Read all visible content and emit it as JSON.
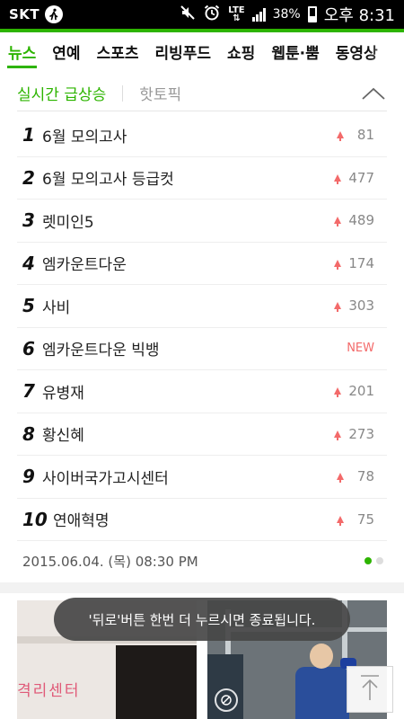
{
  "status_bar": {
    "carrier": "SKT",
    "network": "LTE",
    "battery": "38%",
    "time": "오후 8:31",
    "icons": [
      "running-person-icon",
      "mute-icon",
      "alarm-icon",
      "lte-icon",
      "signal-icon",
      "battery-icon"
    ]
  },
  "tabs": [
    {
      "label": "뉴스",
      "active": true
    },
    {
      "label": "연예",
      "active": false
    },
    {
      "label": "스포츠",
      "active": false
    },
    {
      "label": "리빙푸드",
      "active": false
    },
    {
      "label": "쇼핑",
      "active": false
    },
    {
      "label": "웹툰·뿜",
      "active": false
    },
    {
      "label": "동영상",
      "active": false
    }
  ],
  "panel": {
    "active_tab": "실시간 급상승",
    "inactive_tab": "핫토픽",
    "collapse_icon": "chevron-up-icon"
  },
  "ranking": [
    {
      "rank": "1",
      "term": "6월 모의고사",
      "trend": "up",
      "change": "81"
    },
    {
      "rank": "2",
      "term": "6월 모의고사 등급컷",
      "trend": "up",
      "change": "477"
    },
    {
      "rank": "3",
      "term": "렛미인5",
      "trend": "up",
      "change": "489"
    },
    {
      "rank": "4",
      "term": "엠카운트다운",
      "trend": "up",
      "change": "174"
    },
    {
      "rank": "5",
      "term": "사비",
      "trend": "up",
      "change": "303"
    },
    {
      "rank": "6",
      "term": "엠카운트다운 빅뱅",
      "trend": "new",
      "change": "NEW"
    },
    {
      "rank": "7",
      "term": "유병재",
      "trend": "up",
      "change": "201"
    },
    {
      "rank": "8",
      "term": "황신혜",
      "trend": "up",
      "change": "273"
    },
    {
      "rank": "9",
      "term": "사이버국가고시센터",
      "trend": "up",
      "change": "78"
    },
    {
      "rank": "10",
      "term": "연애혁명",
      "trend": "up",
      "change": "75"
    }
  ],
  "timestamp": "2015.06.04. (목) 08:30 PM",
  "pager": {
    "current": 1,
    "total": 2
  },
  "photos": {
    "left_caption": "격리센터"
  },
  "toast": "'뒤로'버튼 한번 더 누르시면 종료됩니다.",
  "colors": {
    "accent": "#2db400",
    "up": "#f36a6a"
  }
}
